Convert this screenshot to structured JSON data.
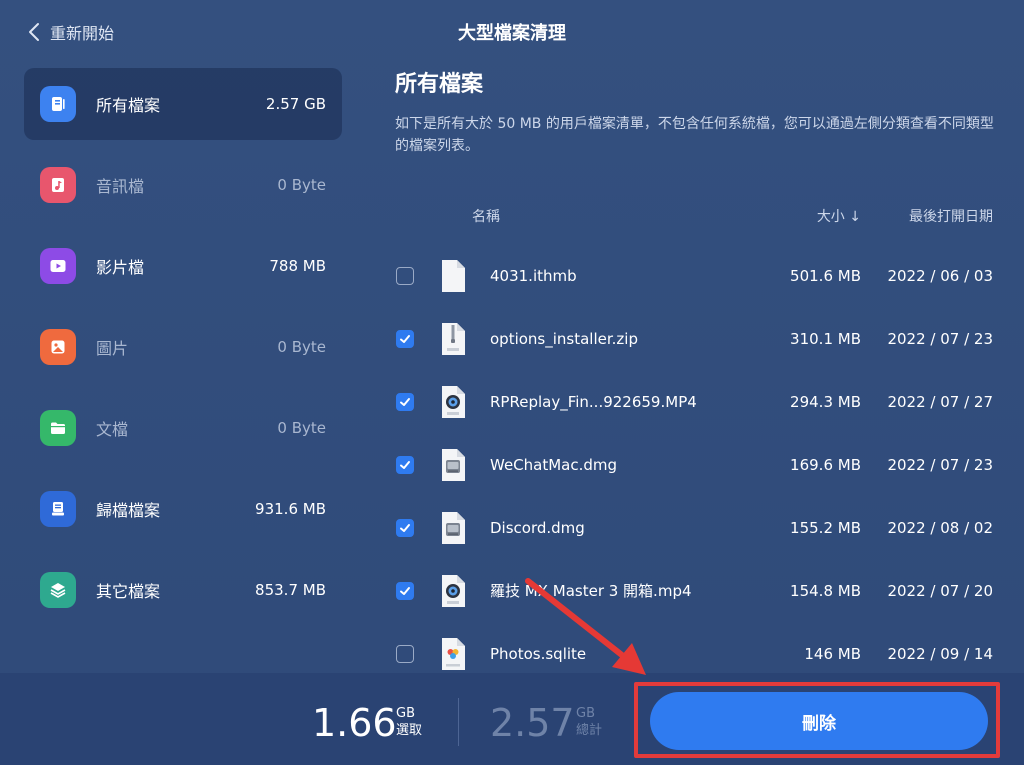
{
  "header": {
    "back_label": "重新開始",
    "title": "大型檔案清理"
  },
  "sidebar": {
    "items": [
      {
        "label": "所有檔案",
        "size": "2.57 GB",
        "color": "#3d82f0",
        "icon": "all-files-icon"
      },
      {
        "label": "音訊檔",
        "size": "0 Byte",
        "color": "#e8566d",
        "icon": "audio-icon"
      },
      {
        "label": "影片檔",
        "size": "788 MB",
        "color": "#8d4be6",
        "icon": "video-icon"
      },
      {
        "label": "圖片",
        "size": "0 Byte",
        "color": "#ef6a3e",
        "icon": "image-icon"
      },
      {
        "label": "文檔",
        "size": "0 Byte",
        "color": "#35b86a",
        "icon": "folder-icon"
      },
      {
        "label": "歸檔檔案",
        "size": "931.6 MB",
        "color": "#2f6ad8",
        "icon": "archive-icon"
      },
      {
        "label": "其它檔案",
        "size": "853.7 MB",
        "color": "#2ea98f",
        "icon": "layers-icon"
      }
    ]
  },
  "main": {
    "heading": "所有檔案",
    "description": "如下是所有大於 50 MB 的用戶檔案清單，不包含任何系統檔，您可以通過左側分類查看不同類型的檔案列表。",
    "columns": {
      "name": "名稱",
      "size": "大小 ↓",
      "date": "最後打開日期"
    },
    "files": [
      {
        "name": "4031.ithmb",
        "size": "501.6 MB",
        "date": "2022 / 06 / 03",
        "checked": false,
        "icon": "blank-file-icon"
      },
      {
        "name": "options_installer.zip",
        "size": "310.1 MB",
        "date": "2022 / 07 / 23",
        "checked": true,
        "icon": "zip-file-icon"
      },
      {
        "name": "RPReplay_Fin...922659.MP4",
        "size": "294.3 MB",
        "date": "2022 / 07 / 27",
        "checked": true,
        "icon": "mp4-file-icon"
      },
      {
        "name": "WeChatMac.dmg",
        "size": "169.6 MB",
        "date": "2022 / 07 / 23",
        "checked": true,
        "icon": "dmg-file-icon"
      },
      {
        "name": "Discord.dmg",
        "size": "155.2 MB",
        "date": "2022 / 08 / 02",
        "checked": true,
        "icon": "dmg-file-icon"
      },
      {
        "name": "羅技 MX Master 3 開箱.mp4",
        "size": "154.8 MB",
        "date": "2022 / 07 / 20",
        "checked": true,
        "icon": "mp4-file-icon"
      },
      {
        "name": "Photos.sqlite",
        "size": "146 MB",
        "date": "2022 / 09 / 14",
        "checked": false,
        "icon": "sqlite-file-icon"
      }
    ]
  },
  "footer": {
    "selected_value": "1.66",
    "selected_unit": "GB",
    "selected_label": "選取",
    "total_value": "2.57",
    "total_unit": "GB",
    "total_label": "總計",
    "delete_label": "刪除"
  },
  "colors": {
    "accent": "#2f7bf0",
    "highlight": "#e23b3b",
    "background": "#2f4a7c"
  }
}
